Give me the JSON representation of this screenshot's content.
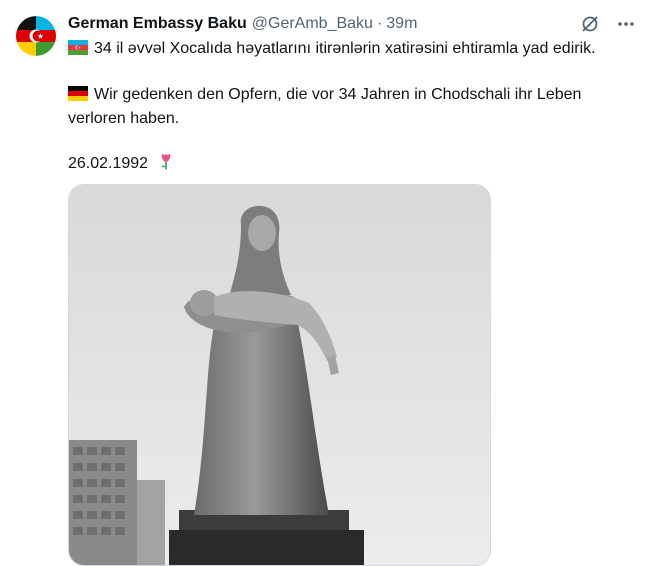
{
  "tweet": {
    "author_name": "German Embassy Baku",
    "handle": "@GerAmb_Baku",
    "separator": "·",
    "time": "39m",
    "line_az": "34 il əvvəl Xocalıda həyatlarını itirənlərin xatirəsini ehtiramla yad edirik.",
    "line_de_1": "Wir gedenken den Opfern, die vor 34 Jahren in Chodschali ihr Leben",
    "line_de_2": "verloren haben.",
    "date": "26.02.1992",
    "icons": [
      "grok-icon",
      "more-icon",
      "azerbaijan-flag-icon",
      "germany-flag-icon",
      "tulip-icon"
    ]
  },
  "colors": {
    "text": "#0f1419",
    "secondary": "#536471",
    "border": "#cfd9de"
  }
}
